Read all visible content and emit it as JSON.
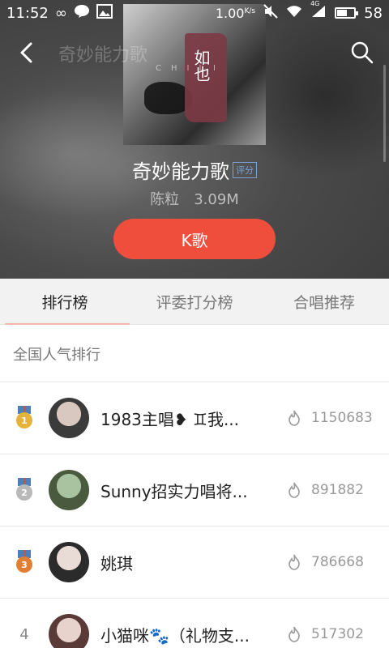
{
  "status_bar": {
    "time": "11:52",
    "speed": "1.00",
    "speed_unit": "K/s",
    "network": "4G",
    "battery": "58",
    "battery_level_pct": 58
  },
  "header": {
    "faded_title": "奇妙能力歌",
    "cover_text": "如也",
    "cover_subtext": "CHILI",
    "song_title": "奇妙能力歌",
    "rating_badge": "评分",
    "artist": "陈粒",
    "file_size": "3.09M",
    "kge_label": "K歌"
  },
  "tabs": [
    {
      "label": "排行榜",
      "active": true
    },
    {
      "label": "评委打分榜",
      "active": false
    },
    {
      "label": "合唱推荐",
      "active": false
    }
  ],
  "section_title": "全国人气排行",
  "ranking": [
    {
      "rank": "1",
      "name": "1983主唱❥ ♊我...",
      "score": "1150683",
      "medal_color": "#e7b23a",
      "ribbon_color": "#4f7fb8",
      "avatar_colors": [
        "#d9c8bf",
        "#3b3b3b"
      ]
    },
    {
      "rank": "2",
      "name": "Sunny招实力唱将...",
      "score": "891882",
      "medal_color": "#b9b9b9",
      "ribbon_color": "#4f7fb8",
      "avatar_colors": [
        "#a9c2a0",
        "#4a5a3e"
      ]
    },
    {
      "rank": "3",
      "name": "姚琪",
      "score": "786668",
      "medal_color": "#e07f33",
      "ribbon_color": "#4f7fb8",
      "avatar_colors": [
        "#e9dcd6",
        "#2b2b2b"
      ]
    },
    {
      "rank": "4",
      "name": "小猫咪🐾（礼物支...",
      "score": "517302",
      "medal_color": "",
      "ribbon_color": "",
      "avatar_colors": [
        "#e8d2cc",
        "#5a3a36"
      ]
    }
  ],
  "colors": {
    "accent": "#f04e3d",
    "tab_bg": "#f2f2f2",
    "rating_badge": "#7aa0d8"
  }
}
